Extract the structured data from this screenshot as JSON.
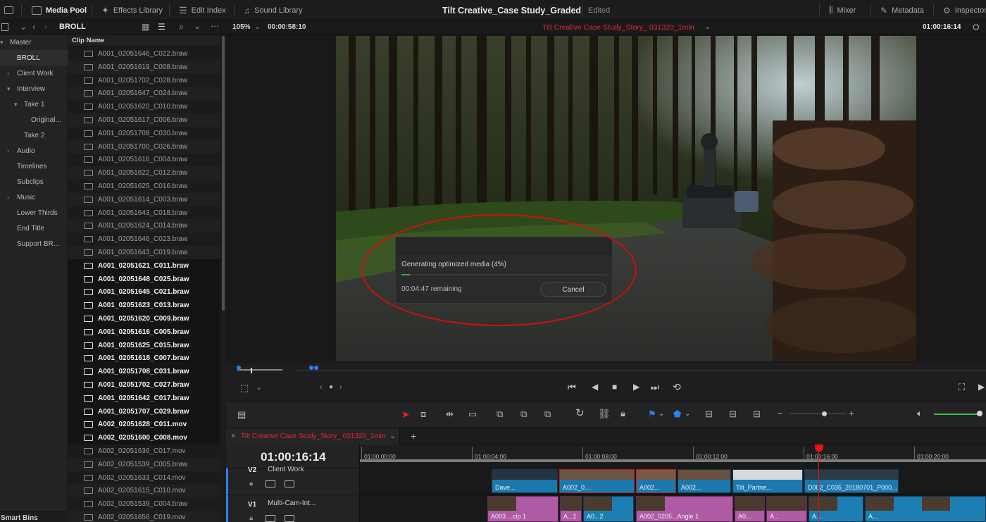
{
  "topbar": {
    "media_pool": "Media Pool",
    "effects_library": "Effects Library",
    "edit_index": "Edit Index",
    "sound_library": "Sound Library",
    "project_title": "Tilt Creative_Case Study_Graded",
    "status": "Edited",
    "mixer": "Mixer",
    "metadata": "Metadata",
    "inspector": "Inspector"
  },
  "bin_bar": {
    "current_bin": "BROLL",
    "zoom": "105%",
    "source_timecode": "00:00:58:10",
    "timeline_name": "Tilt Creative Case Study_Story_ 031320_1min",
    "record_timecode": "01:00:16:14"
  },
  "bins": [
    {
      "label": "Master",
      "caret": "▾"
    },
    {
      "label": "BROLL",
      "caret": ""
    },
    {
      "label": "Client Work",
      "caret": "›"
    },
    {
      "label": "Interview",
      "caret": "▾"
    },
    {
      "label": "Take 1",
      "caret": "▾"
    },
    {
      "label": "Original...",
      "caret": ""
    },
    {
      "label": "Take 2",
      "caret": ""
    },
    {
      "label": "Audio",
      "caret": "›"
    },
    {
      "label": "Timelines",
      "caret": ""
    },
    {
      "label": "Subclips",
      "caret": ""
    },
    {
      "label": "Music",
      "caret": "›"
    },
    {
      "label": "Lower Thirds",
      "caret": ""
    },
    {
      "label": "End Title",
      "caret": ""
    },
    {
      "label": "Support BR...",
      "caret": ""
    }
  ],
  "smart_bins_label": "Smart Bins",
  "clip_list": {
    "header": "Clip Name",
    "clips": [
      "A001_02051646_C022.braw",
      "A001_02051619_C008.braw",
      "A001_02051702_C028.braw",
      "A001_02051647_C024.braw",
      "A001_02051620_C010.braw",
      "A001_02051617_C006.braw",
      "A001_02051708_C030.braw",
      "A001_02051700_C026.braw",
      "A001_02051616_C004.braw",
      "A001_02051622_C012.braw",
      "A001_02051625_C016.braw",
      "A001_02051614_C003.braw",
      "A001_02051643_C018.braw",
      "A001_02051624_C014.braw",
      "A001_02051646_C023.braw",
      "A001_02051643_C019.braw",
      "A001_02051621_C011.braw",
      "A001_02051648_C025.braw",
      "A001_02051645_C021.braw",
      "A001_02051623_C013.braw",
      "A001_02051620_C009.braw",
      "A001_02051616_C005.braw",
      "A001_02051625_C015.braw",
      "A001_02051618_C007.braw",
      "A001_02051708_C031.braw",
      "A001_02051702_C027.braw",
      "A001_02051642_C017.braw",
      "A001_02051707_C029.braw",
      "A002_02051628_C011.mov",
      "A002_02051600_C008.mov",
      "A002_02051636_C017.mov",
      "A002_02051539_C005.braw",
      "A002_02051633_C014.mov",
      "A002_02051615_C010.mov",
      "A002_02051539_C004.braw",
      "A002_02051656_C019.mov"
    ]
  },
  "dialog": {
    "message": "Generating optimized media (4%)",
    "progress_percent": 4,
    "remaining": "00:04:47 remaining",
    "cancel_label": "Cancel"
  },
  "timeline": {
    "tab_name": "Tilt Creative Case Study_Story_ 031320_1min",
    "timecode": "01:00:16:14",
    "ruler_marks": [
      "01:00:00:00",
      "01:00:04:00",
      "01:00:08:00",
      "01:00:12:00",
      "01:00:16:00",
      "01:00:20:00"
    ],
    "tracks": [
      {
        "id": "V2",
        "name": "Client Work"
      },
      {
        "id": "V1",
        "name": "Multi-Cam-Int..."
      }
    ],
    "v2_clips": [
      "Dave...",
      "A002_0...",
      "A002...",
      "A002...",
      "Tilt_Partne...",
      "D002_C035_20180701_P000..."
    ],
    "v1_clips": [
      "A003 ...clp 1",
      "A...1",
      "A0...2",
      "A002_0205...Angle 1",
      "A0...",
      "A...",
      "A...",
      "A..."
    ]
  },
  "colors": {
    "accent_red": "#d10f0f",
    "clip_blue": "#1b79ad",
    "clip_pink": "#b05aa5",
    "progress_green": "#2fb13a",
    "volume_green": "#3fc13e"
  }
}
